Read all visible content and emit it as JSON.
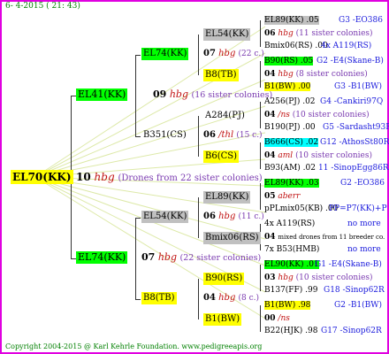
{
  "header": "6- 4-2015 ( 21: 43)",
  "footer": "Copyright 2004-2015 @ Karl Kehrle Foundation.   www.pedigreeapis.org",
  "root": {
    "name": "EL70(KK)",
    "num": "10",
    "hbg": "hbg",
    "desc": "(Drones from 22 sister colonies)"
  },
  "gen1": [
    {
      "name": "EL41(KK)",
      "num": "09",
      "hbg": "hbg",
      "desc": "(16 sister colonies)"
    },
    {
      "name": "EL74(KK)",
      "num": "07",
      "hbg": "hbg",
      "desc": "(22 sister colonies)"
    }
  ],
  "gen2": [
    {
      "name": "EL74(KK)",
      "num": "07",
      "hbg": "hbg",
      "desc": "(22 c.)"
    },
    {
      "name": "B351(CS)",
      "num": "06",
      "hbg": "/thl",
      "desc": "(15 c.)"
    },
    {
      "name": "EL54(KK)",
      "num": "06",
      "hbg": "hbg",
      "desc": "(11 c.)"
    },
    {
      "name": "B8(TB)",
      "num": "04",
      "hbg": "hbg",
      "desc": "(8 c.)"
    }
  ],
  "gen3": [
    {
      "name": "EL54(KK)"
    },
    {
      "name": "B8(TB)"
    },
    {
      "name": "A284(PJ)"
    },
    {
      "name": "B6(CS)"
    },
    {
      "name": "EL89(KK)"
    },
    {
      "name": "Bmix06(RS)"
    },
    {
      "name": "B90(RS)"
    },
    {
      "name": "B1(BW)"
    }
  ],
  "gen4": [
    {
      "a": "EL89(KK) .05",
      "ar": "G3 -EO386",
      "n": "06",
      "h": "hbg",
      "d": "(11 sister colonies)",
      "b": "Bmix06(RS) .00",
      "br": "4x A119(RS)"
    },
    {
      "a": "B90(RS) .05",
      "ar": "G2 -E4(Skane-B)",
      "n": "04",
      "h": "hbg",
      "d": "(8 sister colonies)",
      "b": "B1(BW) .00",
      "br": "G3 -B1(BW)"
    },
    {
      "a": "A256(PJ) .02",
      "ar": "G4 -Cankiri97Q",
      "n": "04",
      "h": "/ns",
      "d": "(10 sister colonies)",
      "b": "B190(PJ) .00",
      "br": "G5 -Sardasht93R"
    },
    {
      "a": "B666(CS) .02",
      "ar": "G12 -AthosSt80R",
      "n": "04",
      "h": "aml",
      "d": "(10 sister colonies)",
      "b": "B93(AM) .02",
      "br": "11 -SinopEgg86R"
    },
    {
      "a": "EL89(KK) .03",
      "ar": "G2 -EO386",
      "n": "05",
      "h": "aberr",
      "d": "",
      "b": "pPLmix05(KB) .00",
      "br": "PP=P7(KK)+P"
    },
    {
      "a": "4x A119(RS)",
      "ar": "no more",
      "n": "04",
      "h": "",
      "d": "mixed drones from 11 breeder co.",
      "b": "7x B53(HMB)",
      "br": "no more"
    },
    {
      "a": "EL90(KK) .01",
      "ar": "G1 -E4(Skane-B)",
      "n": "03",
      "h": "hbg",
      "d": "(10 sister colonies)",
      "b": "B137(FF) .99",
      "br": "G18 -Sinop62R"
    },
    {
      "a": "B1(BW) .98",
      "ar": "G2 -B1(BW)",
      "n": "00",
      "h": "/ns",
      "d": "",
      "b": "B22(HJK) .98",
      "br": "G17 -Sinop62R"
    }
  ]
}
